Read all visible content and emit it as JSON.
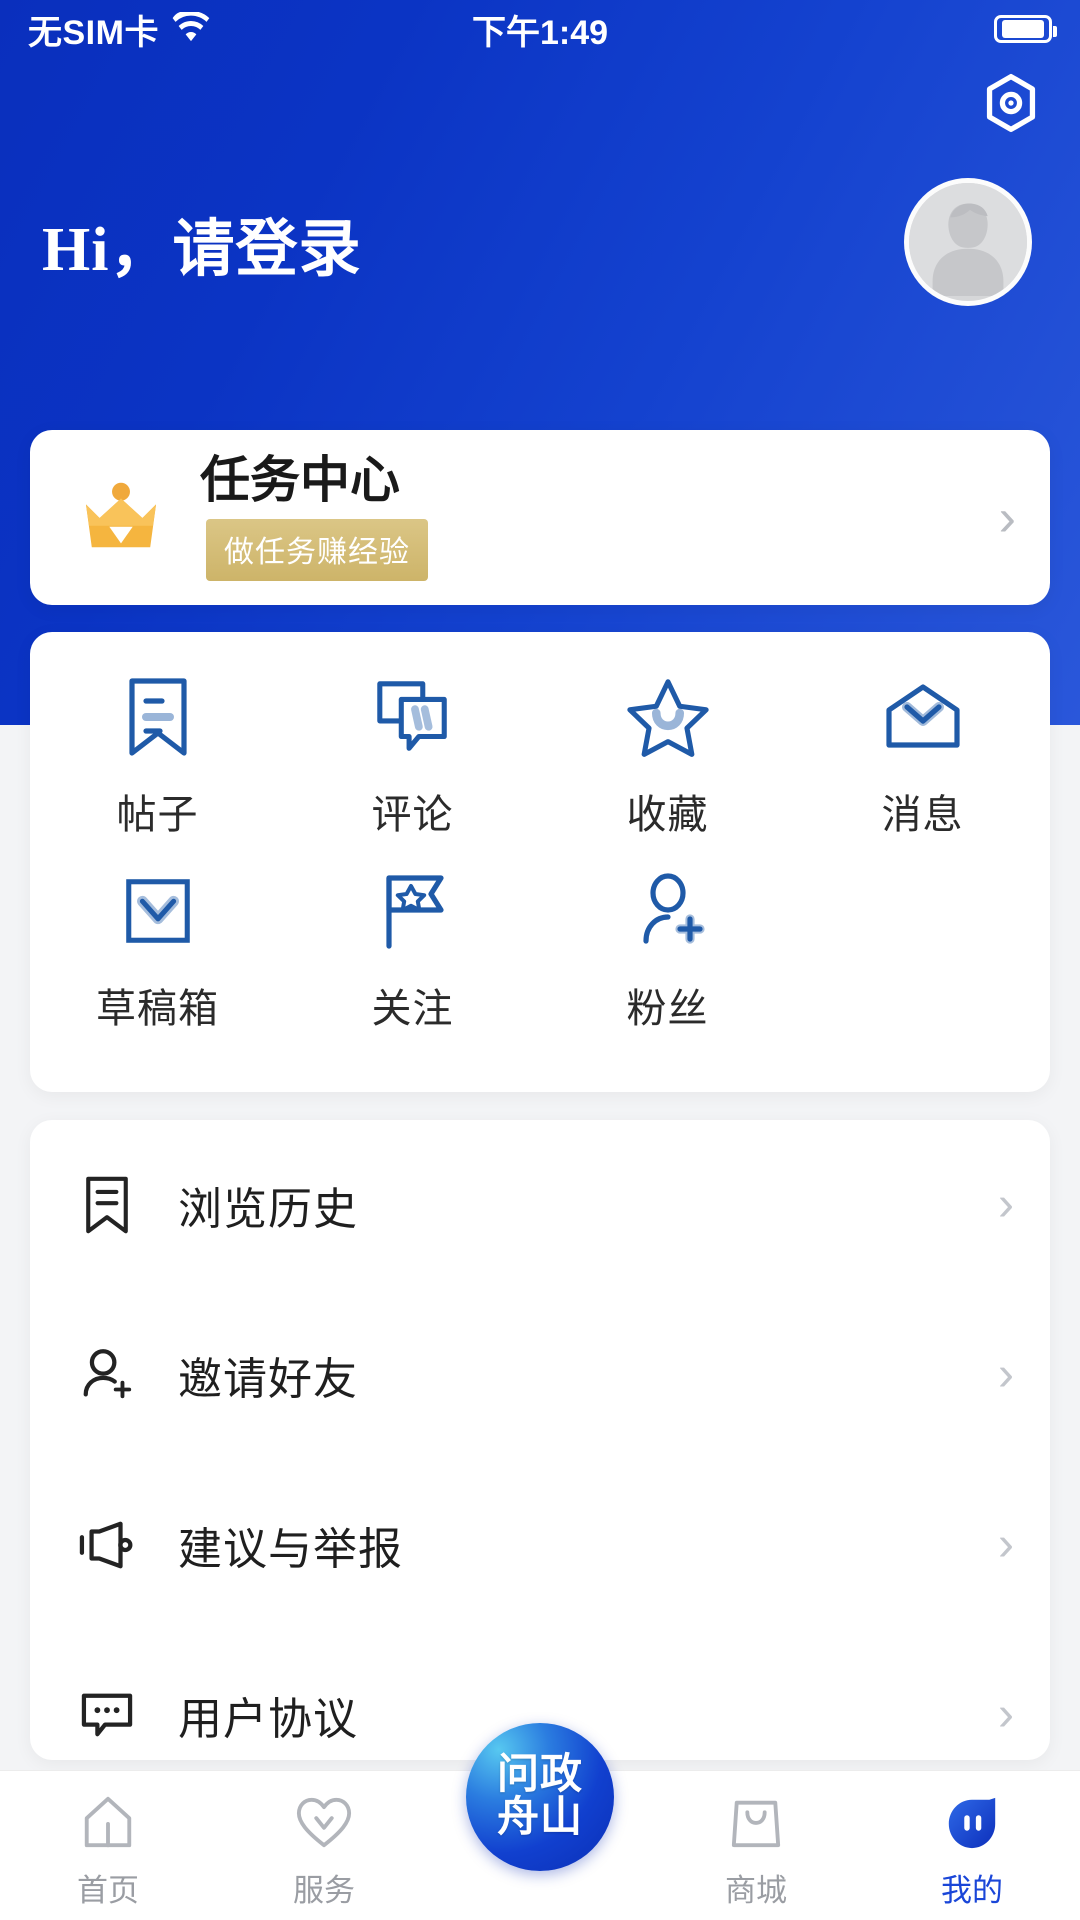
{
  "status_bar": {
    "carrier": "无SIM卡",
    "wifi_icon": "wifi-icon",
    "time": "下午1:49",
    "battery_icon": "battery-icon"
  },
  "header": {
    "settings_icon": "settings-hexagon-icon",
    "greeting": "Hi，请登录",
    "avatar_icon": "default-avatar-icon",
    "background_color": "#0b33c3"
  },
  "task_card": {
    "crown_icon": "crown-icon",
    "title": "任务中心",
    "badge": "做任务赚经验",
    "badge_color": "#d2ba74",
    "chevron": "›"
  },
  "grid": {
    "rows": [
      [
        {
          "label": "帖子",
          "icon": "post-bookmark-icon"
        },
        {
          "label": "评论",
          "icon": "comment-bubbles-icon"
        },
        {
          "label": "收藏",
          "icon": "star-favorite-icon"
        },
        {
          "label": "消息",
          "icon": "envelope-message-icon"
        }
      ],
      [
        {
          "label": "草稿箱",
          "icon": "draft-box-icon"
        },
        {
          "label": "关注",
          "icon": "flag-following-icon"
        },
        {
          "label": "粉丝",
          "icon": "follower-person-add-icon"
        }
      ]
    ],
    "accent_color": "#1f5aa8"
  },
  "list": {
    "items": [
      {
        "label": "浏览历史",
        "icon": "history-bookmark-icon",
        "chevron": "›"
      },
      {
        "label": "邀请好友",
        "icon": "invite-person-add-icon",
        "chevron": "›"
      },
      {
        "label": "建议与举报",
        "icon": "megaphone-report-icon",
        "chevron": "›"
      },
      {
        "label": "用户协议",
        "icon": "agreement-bubble-icon",
        "chevron": "›"
      }
    ]
  },
  "tabbar": {
    "items": [
      {
        "label": "首页",
        "icon": "home-icon",
        "active": false
      },
      {
        "label": "服务",
        "icon": "heart-service-icon",
        "active": false
      },
      {
        "label": "商城",
        "icon": "shopping-bag-icon",
        "active": false
      },
      {
        "label": "我的",
        "icon": "profile-droplet-icon",
        "active": true
      }
    ],
    "center_logo": {
      "line1": "问政",
      "line2": "舟山"
    },
    "active_color": "#1a46d8",
    "inactive_color": "#9a9da3"
  }
}
